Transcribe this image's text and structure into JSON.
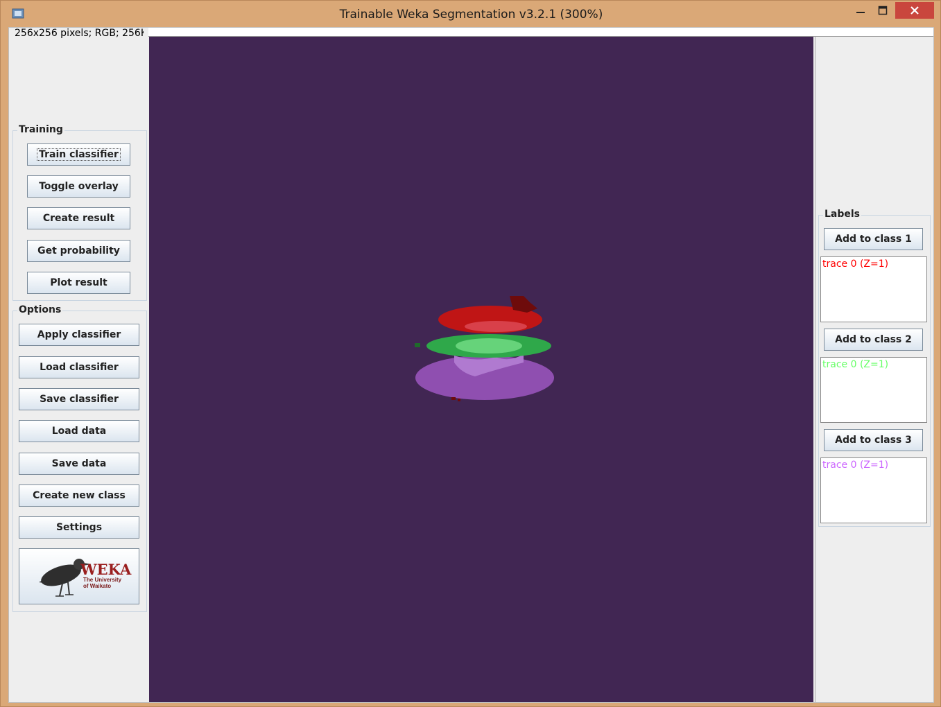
{
  "window": {
    "title": "Trainable Weka Segmentation v3.2.1 (300%)",
    "controls": {
      "minimize": "—",
      "maximize": "☐",
      "close": "✕"
    }
  },
  "status": {
    "text": "256x256 pixels; RGB; 256K"
  },
  "training": {
    "legend": "Training",
    "buttons": [
      "Train classifier",
      "Toggle overlay",
      "Create result",
      "Get probability",
      "Plot result"
    ]
  },
  "options": {
    "legend": "Options",
    "buttons": [
      "Apply classifier",
      "Load classifier",
      "Save classifier",
      "Load data",
      "Save data",
      "Create new class",
      "Settings"
    ]
  },
  "logo": {
    "brand": "WEKA",
    "subtitle_line1": "The University",
    "subtitle_line2": "of Waikato"
  },
  "labels": {
    "legend": "Labels",
    "classes": [
      {
        "button": "Add to class 1",
        "trace": "trace 0 (Z=1)",
        "color": "#ff0000"
      },
      {
        "button": "Add to class 2",
        "trace": "trace 0 (Z=1)",
        "color": "#66ff66"
      },
      {
        "button": "Add to class 3",
        "trace": "trace 0 (Z=1)",
        "color": "#cc66ff"
      }
    ]
  },
  "canvas": {
    "background": "#412653"
  }
}
